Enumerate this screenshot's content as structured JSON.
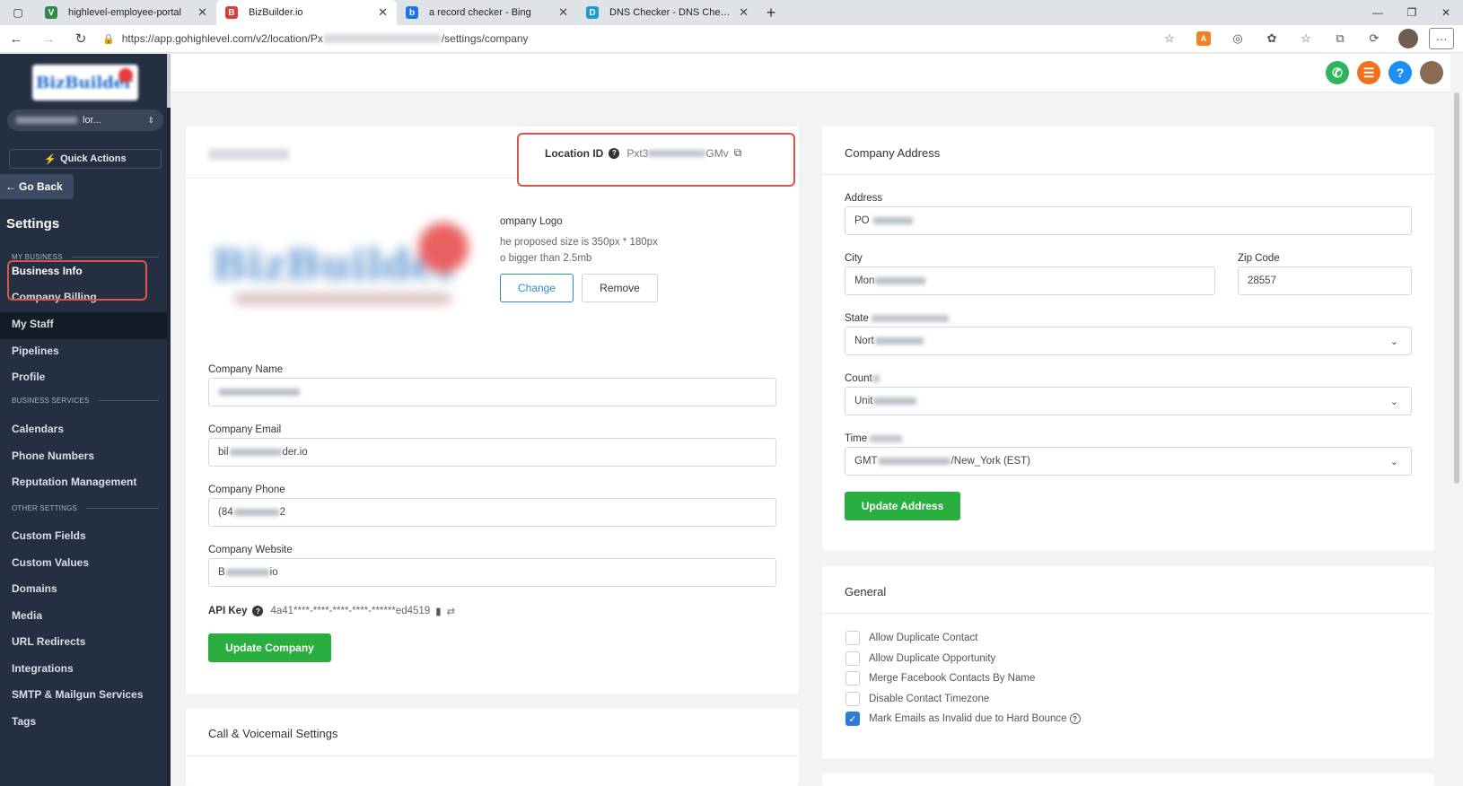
{
  "browser": {
    "tabs": [
      {
        "label": "highlevel-employee-portal",
        "fav": "V",
        "fav_color": "#2f8a4b"
      },
      {
        "label": "BizBuilder.io",
        "fav": "B",
        "fav_color": "#e03b3b"
      },
      {
        "label": "a record checker - Bing",
        "fav": "b",
        "fav_color": "#1a73e8"
      },
      {
        "label": "DNS Checker - DNS Check Prop",
        "fav": "D",
        "fav_color": "#1a9bd7"
      }
    ],
    "url_prefix": "https://app.gohighlevel.com/v2/location/Px",
    "url_suffix": "/settings/company"
  },
  "sidebar": {
    "account_suffix": "lor...",
    "quick_actions": "Quick Actions",
    "go_back": "Go Back",
    "title": "Settings",
    "section_my_business": "MY BUSINESS",
    "section_business_services": "BUSINESS SERVICES",
    "section_other_settings": "OTHER SETTINGS",
    "items": {
      "business_info": "Business Info",
      "company_billing": "Company Billing",
      "my_staff": "My Staff",
      "pipelines": "Pipelines",
      "profile": "Profile",
      "calendars": "Calendars",
      "phone_numbers": "Phone Numbers",
      "reputation": "Reputation Management",
      "custom_fields": "Custom Fields",
      "custom_values": "Custom Values",
      "domains": "Domains",
      "media": "Media",
      "url_redirects": "URL Redirects",
      "integrations": "Integrations",
      "smtp": "SMTP & Mailgun Services",
      "tags": "Tags"
    }
  },
  "company": {
    "location_id_label": "Location ID",
    "location_id_prefix": "Pxt3",
    "location_id_suffix": "GMv",
    "logo_title": "ompany Logo",
    "logo_hint1": "he proposed size is 350px * 180px",
    "logo_hint2": "o bigger than 2.5mb",
    "change": "Change",
    "remove": "Remove",
    "name_label": "Company Name",
    "email_label": "Company Email",
    "email_prefix": "bil",
    "email_suffix": "der.io",
    "phone_label": "Company Phone",
    "phone_prefix": "(84",
    "phone_suffix": "2",
    "website_label": "Company Website",
    "website_prefix": "B",
    "website_suffix": "io",
    "api_key_label": "API Key",
    "api_key_value": "4a41****-****-****-****-******ed4519",
    "update_company": "Update Company"
  },
  "call_settings": {
    "title": "Call & Voicemail Settings"
  },
  "address": {
    "title": "Company Address",
    "address_label": "Address",
    "address_prefix": "PO",
    "city_label": "City",
    "city_prefix": "Mon",
    "zip_label": "Zip Code",
    "zip_value": "28557",
    "state_label": "State",
    "state_prefix": "Nort",
    "country_label": "Count",
    "country_prefix": "Unit",
    "tz_label": "Time",
    "tz_prefix": "GMT",
    "tz_suffix": "/New_York (EST)",
    "update_address": "Update Address"
  },
  "general": {
    "title": "General",
    "options": [
      {
        "label": "Allow Duplicate Contact",
        "checked": false
      },
      {
        "label": "Allow Duplicate Opportunity",
        "checked": false
      },
      {
        "label": "Merge Facebook Contacts By Name",
        "checked": false
      },
      {
        "label": "Disable Contact Timezone",
        "checked": false
      },
      {
        "label": "Mark Emails as Invalid due to Hard Bounce",
        "checked": true
      }
    ]
  }
}
